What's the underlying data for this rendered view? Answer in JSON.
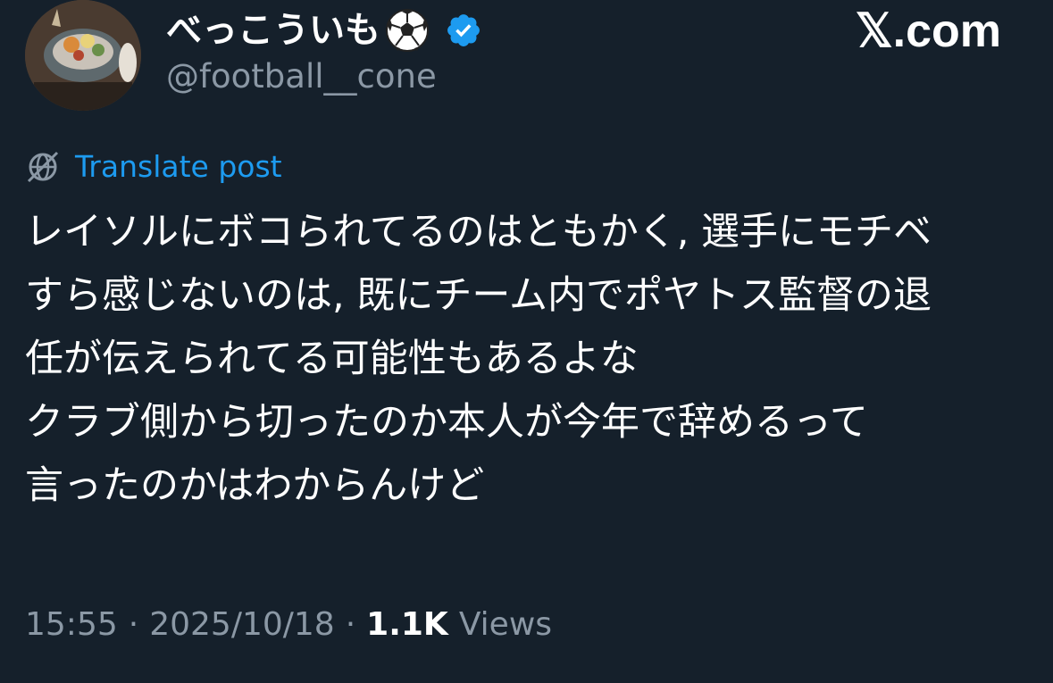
{
  "author": {
    "display_name": "べっこういも",
    "display_emoji": "soccer-ball-icon",
    "verified_icon": "verified-badge-icon",
    "verified_color": "#1d9bf0",
    "handle": "@football__cone"
  },
  "brand": {
    "label": "𝕏.com"
  },
  "translate": {
    "icon": "globe-icon",
    "label": "Translate post"
  },
  "tweet": {
    "lines": [
      "レイソルにボコられてるのはともかく, 選手にモチベ",
      "すら感じないのは, 既にチーム内でポヤトス監督の退",
      "任が伝えられてる可能性もあるよな",
      "クラブ側から切ったのか本人が今年で辞めるって",
      "言ったのかはわからんけど"
    ]
  },
  "meta": {
    "time": "15:55",
    "separator": "·",
    "date": "2025/10/18",
    "views_count": "1.1K",
    "views_label": "Views"
  },
  "colors": {
    "background": "#15202b",
    "text": "#ffffff",
    "secondary": "#8b98a5",
    "accent": "#1d9bf0"
  }
}
